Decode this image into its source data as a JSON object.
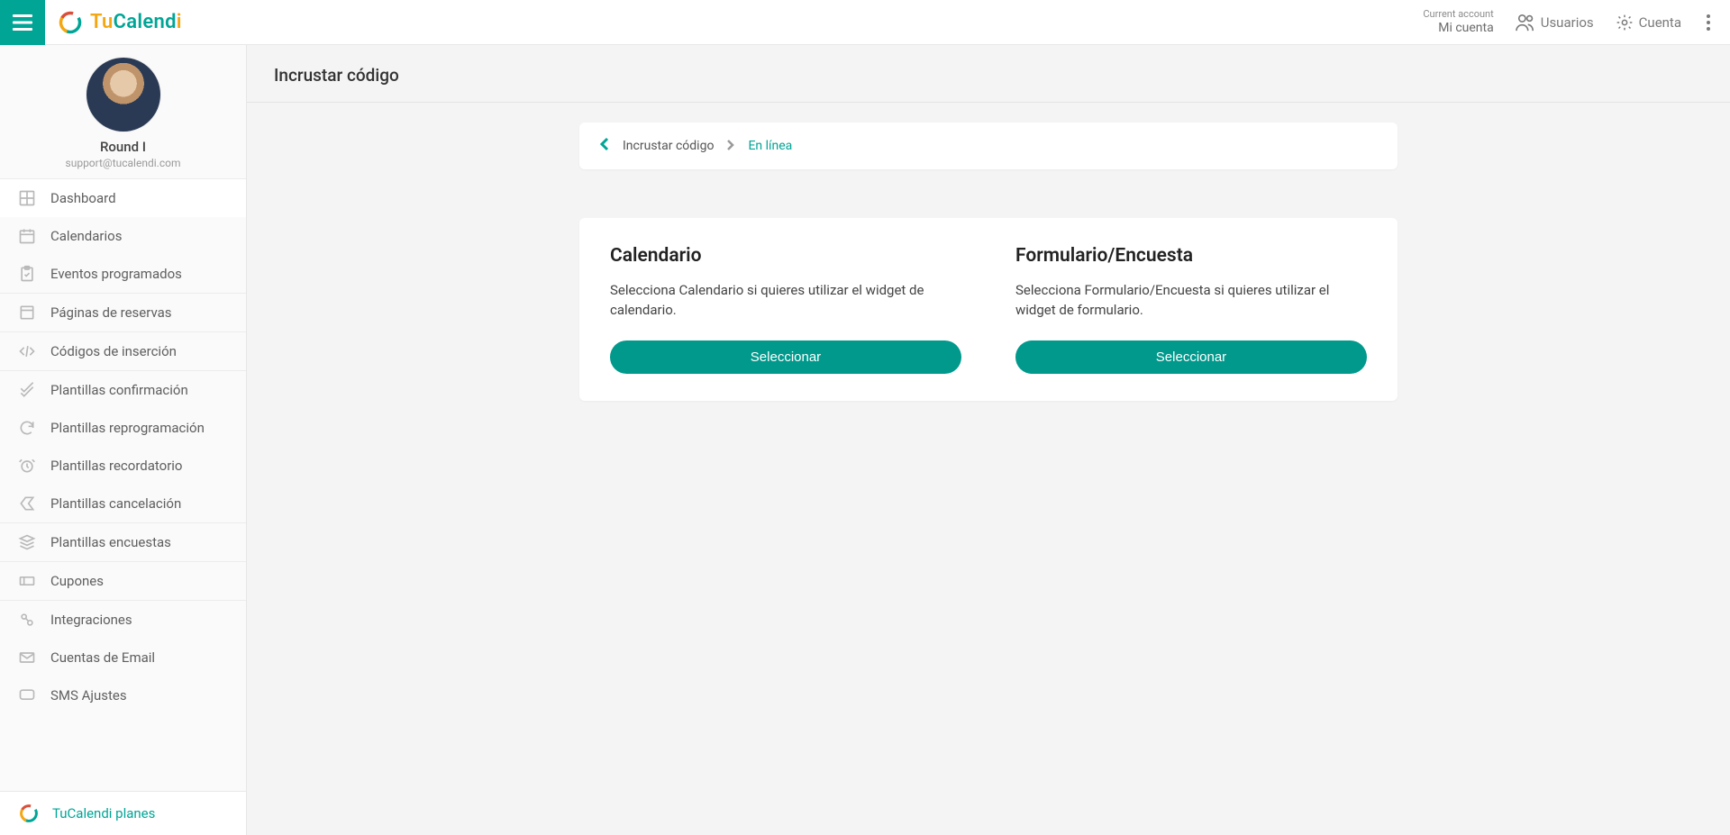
{
  "brand": {
    "part1": "Tu",
    "part2": "Calend",
    "part3": "i"
  },
  "header": {
    "current_account_label": "Current account",
    "current_account_name": "Mi cuenta",
    "users_label": "Usuarios",
    "account_label": "Cuenta"
  },
  "profile": {
    "name": "Round I",
    "email": "support@tucalendi.com"
  },
  "sidebar": {
    "items": [
      {
        "label": "Dashboard"
      },
      {
        "label": "Calendarios"
      },
      {
        "label": "Eventos programados"
      },
      {
        "label": "Páginas de reservas"
      },
      {
        "label": "Códigos de inserción"
      },
      {
        "label": "Plantillas confirmación"
      },
      {
        "label": "Plantillas reprogramación"
      },
      {
        "label": "Plantillas recordatorio"
      },
      {
        "label": "Plantillas cancelación"
      },
      {
        "label": "Plantillas encuestas"
      },
      {
        "label": "Cupones"
      },
      {
        "label": "Integraciones"
      },
      {
        "label": "Cuentas de Email"
      },
      {
        "label": "SMS Ajustes"
      }
    ],
    "footer_link": "TuCalendi planes"
  },
  "page": {
    "title": "Incrustar código",
    "breadcrumb": {
      "root": "Incrustar código",
      "current": "En línea"
    },
    "options": [
      {
        "title": "Calendario",
        "desc": "Selecciona Calendario si quieres utilizar el widget de calendario.",
        "button": "Seleccionar"
      },
      {
        "title": "Formulario/Encuesta",
        "desc": "Selecciona Formulario/Encuesta si quieres utilizar el widget de formulario.",
        "button": "Seleccionar"
      }
    ]
  }
}
